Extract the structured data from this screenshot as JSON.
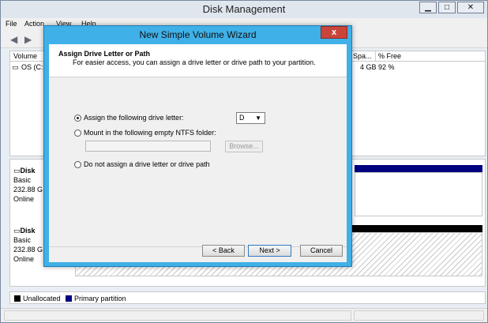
{
  "window": {
    "title": "Disk Management",
    "controls": {
      "minimize": "▁",
      "maximize": "□",
      "close": "✕"
    }
  },
  "menu": [
    "File",
    "Action",
    "View",
    "Help"
  ],
  "volume_list": {
    "columns": [
      "Volume",
      "Spa...",
      "% Free"
    ],
    "rows": [
      {
        "volume": "OS (C:",
        "space": "4 GB",
        "free": "92 %"
      }
    ]
  },
  "disks": [
    {
      "name": "Disk",
      "type": "Basic",
      "size": "232.88 G",
      "status": "Online"
    },
    {
      "name": "Disk",
      "type": "Basic",
      "size": "232.88 G",
      "status": "Online"
    }
  ],
  "legend": {
    "items": [
      {
        "label": "Unallocated",
        "color": "#000000"
      },
      {
        "label": "Primary partition",
        "color": "#000080"
      }
    ]
  },
  "wizard": {
    "title": "New Simple Volume Wizard",
    "close": "x",
    "heading": "Assign Drive Letter or Path",
    "subheading": "For easier access, you can assign a drive letter or drive path to your partition.",
    "options": [
      {
        "label": "Assign the following drive letter:",
        "selected": true
      },
      {
        "label": "Mount in the following empty NTFS folder:",
        "selected": false
      },
      {
        "label": "Do not assign a drive letter or drive path",
        "selected": false
      }
    ],
    "drive_letter": "D",
    "folder_path": "",
    "browse": "Browse...",
    "back": "< Back",
    "next": "Next >",
    "cancel": "Cancel"
  }
}
